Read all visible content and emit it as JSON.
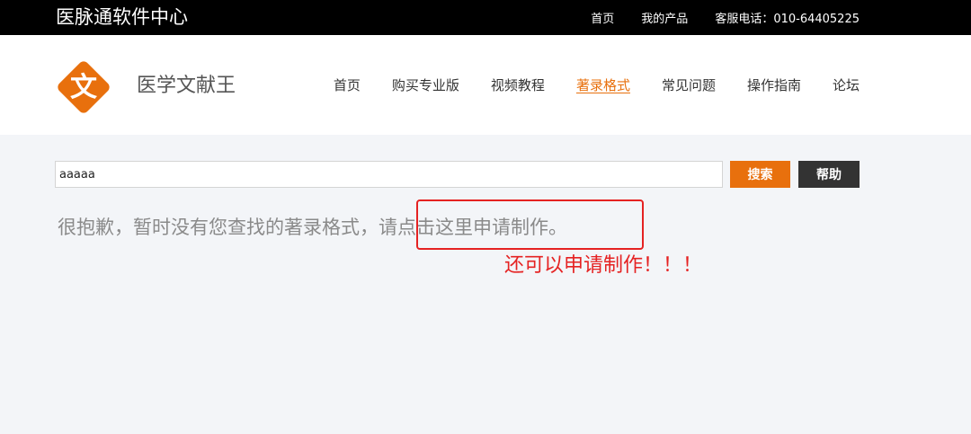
{
  "topbar": {
    "brand": "医脉通软件中心",
    "links": [
      {
        "label": "首页"
      },
      {
        "label": "我的产品"
      },
      {
        "label": "客服电话：010-64405225"
      }
    ]
  },
  "header": {
    "logo_glyph": "文",
    "site_name": "医学文献王",
    "nav": [
      {
        "label": "首页",
        "active": false
      },
      {
        "label": "购买专业版",
        "active": false
      },
      {
        "label": "视频教程",
        "active": false
      },
      {
        "label": "著录格式",
        "active": true
      },
      {
        "label": "常见问题",
        "active": false
      },
      {
        "label": "操作指南",
        "active": false
      },
      {
        "label": "论坛",
        "active": false
      }
    ]
  },
  "search": {
    "value": "aaaaa",
    "search_label": "搜索",
    "help_label": "帮助"
  },
  "result": {
    "message": "很抱歉，暂时没有您查找的著录格式，",
    "apply_link": "请点击这里申请制作。"
  },
  "annotation": {
    "text": "还可以申请制作！！！"
  },
  "colors": {
    "accent": "#e8700d",
    "topbar": "#000000",
    "annotation": "#e52222"
  }
}
